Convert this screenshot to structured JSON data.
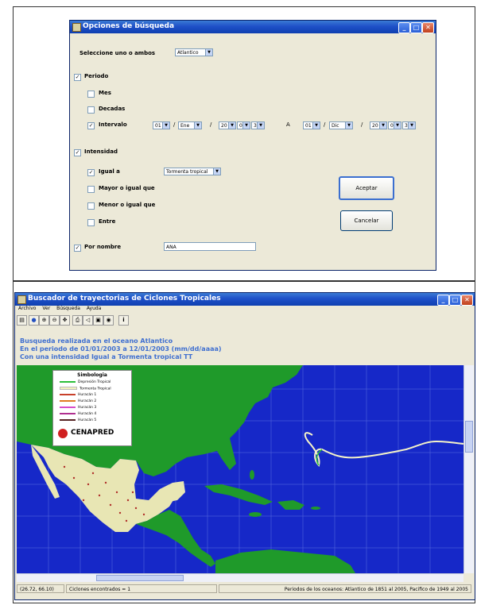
{
  "dialog": {
    "title": "Opciones de búsqueda",
    "select_label": "Seleccione uno o ambos",
    "ocean_value": "Atlantico",
    "period": {
      "label": "Periodo",
      "mes": "Mes",
      "decadas": "Decadas",
      "intervalo": "Intervalo",
      "from": {
        "day": "01",
        "month": "Ene",
        "century": "20",
        "decade": "0",
        "year": "3"
      },
      "separator": "A",
      "slash": "/",
      "to": {
        "day": "01",
        "month": "Dic",
        "century": "20",
        "decade": "0",
        "year": "3"
      }
    },
    "intensity": {
      "label": "Intensidad",
      "igual": "Igual a",
      "igual_value": "Tormenta tropical",
      "mayor": "Mayor o igual que",
      "menor": "Menor o igual que",
      "entre": "Entre"
    },
    "name": {
      "label": "Por nombre",
      "value": "ANA"
    },
    "accept": "Aceptar",
    "cancel": "Cancelar",
    "check_mark": "✓"
  },
  "app": {
    "title": "Buscador de trayectorias de Ciclones Tropicales",
    "menu": [
      "Archivo",
      "Ver",
      "Búsqueda",
      "Ayuda"
    ],
    "info": [
      "Busqueda realizada en el oceano Atlantico",
      "En el periodo de 01/01/2003 a 12/01/2003  (mm/dd/aaaa)",
      "Con una intensidad  Igual a Tormenta tropical TT"
    ],
    "legend": {
      "title": "Simbologia",
      "items": [
        {
          "label": "Depresión Tropical",
          "color": "#2bbf3a"
        },
        {
          "label": "Tormenta Tropical",
          "color": "#f2f2c0"
        },
        {
          "label": "Huracán 1",
          "color": "#c8402a"
        },
        {
          "label": "Huracán 2",
          "color": "#e07a20"
        },
        {
          "label": "Huracán 3",
          "color": "#d84cc8"
        },
        {
          "label": "Huracán 4",
          "color": "#b03090"
        },
        {
          "label": "Huracán 5",
          "color": "#552222"
        }
      ],
      "logo_text": "CENAPRED"
    },
    "status": {
      "coords": "(26.72, 66.10)",
      "found": "Ciclones encontrados = 1",
      "periods": "Periodos de los oceanos: Atlantico de 1851 al 2005, Pacifico de 1949 al 2005"
    },
    "colors": {
      "ocean": "#1628c8",
      "land": "#1f9a2a",
      "mexico": "#e8e6b4",
      "track": "#f5f3c8"
    }
  }
}
